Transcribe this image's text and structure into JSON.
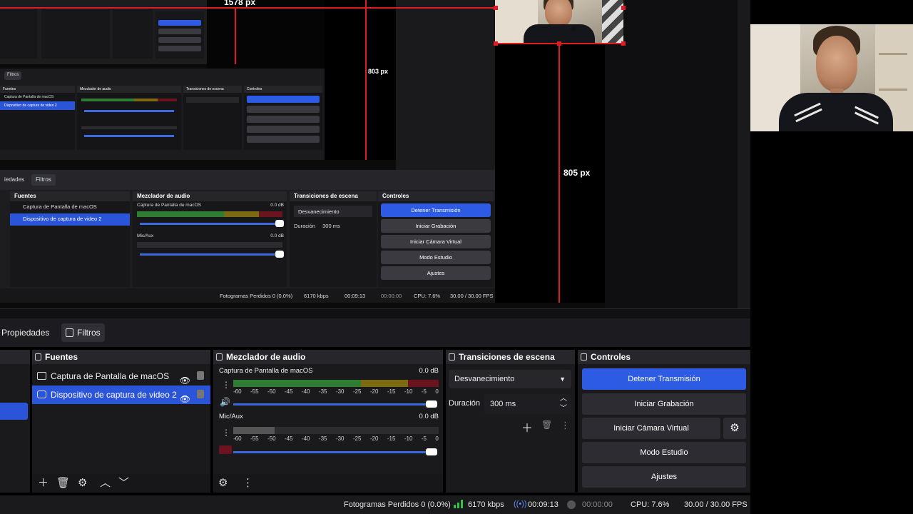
{
  "preview": {
    "dim_width_label": "1578 px",
    "dim_height_label_small": "803 px",
    "dim_height_label_large": "805 px",
    "nested": {
      "tab_properties": "iedades",
      "tab_filters": "Filtros",
      "sources_title": "Fuentes",
      "mixer_title": "Mezclador de audio",
      "transitions_title": "Transiciones de escena",
      "controls_title": "Controles",
      "source_1": "Captura de Pantalla de macOS",
      "source_2": "Dispositivo de captura de video 2",
      "mix_1": "Captura de Pantalla de macOS",
      "mix_2": "Mic/Aux",
      "db_1": "0.0 dB",
      "db_2": "0.0 dB",
      "transition": "Desvanecimiento",
      "duration_label": "Duración",
      "duration_value": "300 ms",
      "buttons": [
        "Detener Transmisión",
        "Iniciar Grabación",
        "Iniciar Cámara Virtual",
        "Modo Estudio",
        "Ajustes"
      ],
      "status": {
        "dropped": "Fotogramas Perdidos 0 (0.0%)",
        "kbps": "6170 kbps",
        "time_live": "00:09:13",
        "time_rec": "00:00:00",
        "cpu": "CPU: 7.6%",
        "fps": "30.00 / 30.00 FPS"
      },
      "tiny_tab": "Filtros"
    }
  },
  "tabs": {
    "properties": "Propiedades",
    "filters": "Filtros"
  },
  "sources": {
    "title": "Fuentes",
    "items": [
      {
        "label": "Captura de Pantalla de macOS",
        "icon": "monitor-icon",
        "selected": false
      },
      {
        "label": "Dispositivo de captura de video 2",
        "icon": "camera-icon",
        "selected": true
      }
    ]
  },
  "mixer": {
    "title": "Mezclador de audio",
    "channels": [
      {
        "name": "Captura de Pantalla de macOS",
        "db": "0.0 dB",
        "level": 1.0
      },
      {
        "name": "Mic/Aux",
        "db": "0.0 dB",
        "level": 1.0
      }
    ],
    "ticks": [
      "-60",
      "-55",
      "-50",
      "-45",
      "-40",
      "-35",
      "-30",
      "-25",
      "-20",
      "-15",
      "-10",
      "-5",
      "0"
    ]
  },
  "transitions": {
    "title": "Transiciones de escena",
    "selected": "Desvanecimiento",
    "duration_label": "Duración",
    "duration_value": "300 ms"
  },
  "controls": {
    "title": "Controles",
    "stop_stream": "Detener Transmisión",
    "start_recording": "Iniciar Grabación",
    "start_virtual_cam": "Iniciar Cámara Virtual",
    "studio_mode": "Modo Estudio",
    "settings": "Ajustes"
  },
  "status": {
    "dropped_frames": "Fotogramas Perdidos 0 (0.0%)",
    "bitrate": "6170 kbps",
    "stream_time": "00:09:13",
    "record_time": "00:00:00",
    "cpu": "CPU: 7.6%",
    "fps": "30.00 / 30.00 FPS"
  },
  "colors": {
    "accent": "#2d5be3",
    "guide_red": "#e01b24",
    "meter_green": "#2e7d32",
    "signal_green": "#35c24a"
  }
}
